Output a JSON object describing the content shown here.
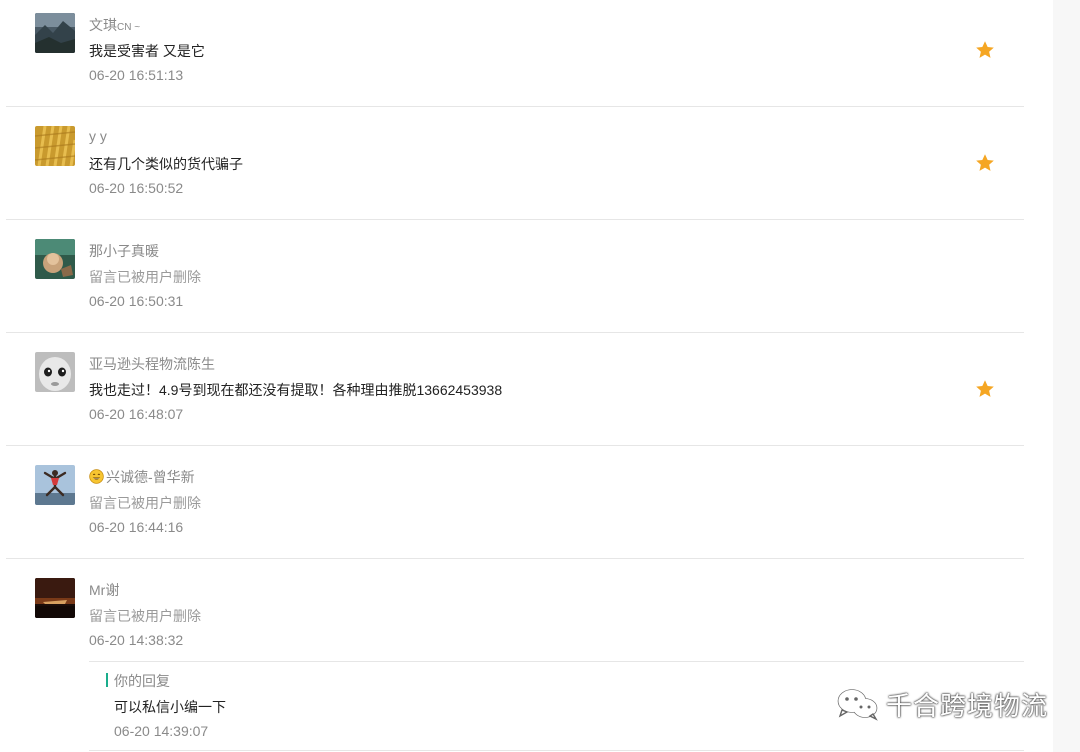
{
  "colors": {
    "star": "#f5a623",
    "reply_accent": "#1aad8c",
    "meta_text": "#8a8a8a",
    "body_text": "#222222",
    "divider": "#e6e6e6"
  },
  "comments": [
    {
      "nickname": "文琪",
      "nickname_suffix": "CN ~",
      "content": "我是受害者 又是它",
      "time": "06-20 16:51:13",
      "starred": true,
      "avatar_icon": "landscape-avatar"
    },
    {
      "nickname": "y y",
      "content": "还有几个类似的货代骗子",
      "time": "06-20 16:50:52",
      "starred": true,
      "avatar_icon": "wheat-avatar"
    },
    {
      "nickname": "那小子真暖",
      "content": "留言已被用户删除",
      "time": "06-20 16:50:31",
      "starred": false,
      "avatar_icon": "photo-avatar"
    },
    {
      "nickname": "亚马逊头程物流陈生",
      "content": "我也走过！4.9号到现在都还没有提取！各种理由推脱13662453938",
      "time": "06-20 16:48:07",
      "starred": true,
      "avatar_icon": "baby-face-avatar"
    },
    {
      "nickname": "兴诚德-曾华新",
      "content": "留言已被用户删除",
      "time": "06-20 16:44:16",
      "starred": false,
      "avatar_icon": "jumping-person-avatar"
    },
    {
      "nickname": "Mr谢",
      "content": "留言已被用户删除",
      "time": "06-20 14:38:32",
      "starred": false,
      "avatar_icon": "sunset-avatar"
    }
  ],
  "reply": {
    "label": "你的回复",
    "content": "可以私信小编一下",
    "time": "06-20 14:39:07"
  },
  "watermark": {
    "text": "千合跨境物流",
    "icon": "wechat-icon"
  }
}
